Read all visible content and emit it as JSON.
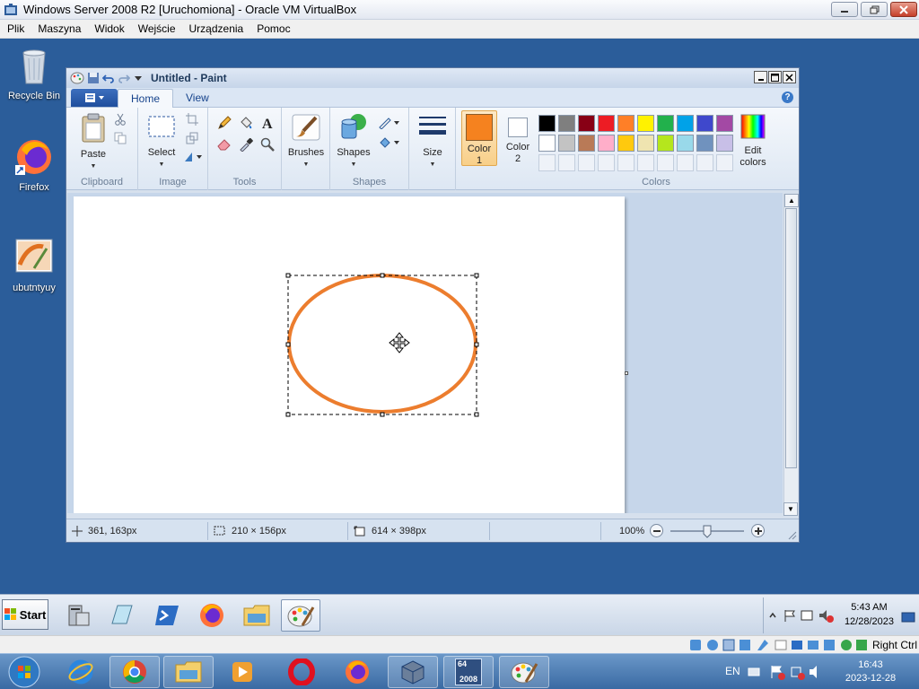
{
  "vbox": {
    "title": "Windows Server 2008 R2 [Uruchomiona] - Oracle VM VirtualBox",
    "menu": [
      "Plik",
      "Maszyna",
      "Widok",
      "Wejście",
      "Urządzenia",
      "Pomoc"
    ],
    "status_host_key": "Right Ctrl"
  },
  "desktop": {
    "icons": [
      {
        "label": "Recycle Bin",
        "icon": "recycle-bin-icon"
      },
      {
        "label": "Firefox",
        "icon": "firefox-icon"
      },
      {
        "label": "ubutntyuy",
        "icon": "paint-file-icon"
      }
    ]
  },
  "paint": {
    "title": "Untitled - Paint",
    "tabs": [
      "Home",
      "View"
    ],
    "active_tab": "Home",
    "groups": {
      "clipboard": {
        "label": "Clipboard",
        "paste": "Paste"
      },
      "image": {
        "label": "Image",
        "select": "Select"
      },
      "tools": {
        "label": "Tools"
      },
      "brushes": {
        "label": "Brushes"
      },
      "shapes": {
        "label": "Shapes",
        "shapes_btn": "Shapes"
      },
      "size": {
        "label": "Size"
      },
      "color1": {
        "line1": "Color",
        "line2": "1",
        "value": "#f5821f"
      },
      "color2": {
        "line1": "Color",
        "line2": "2",
        "value": "#ffffff"
      },
      "colors": {
        "label": "Colors",
        "edit_line1": "Edit",
        "edit_line2": "colors"
      }
    },
    "palette_row1": [
      "#000000",
      "#7f7f7f",
      "#880015",
      "#ed1c24",
      "#ff7f27",
      "#fff200",
      "#22b14c",
      "#00a2e8",
      "#3f48cc",
      "#a349a4"
    ],
    "palette_row2": [
      "#ffffff",
      "#c3c3c3",
      "#b97a57",
      "#ffaec9",
      "#ffc90e",
      "#efe4b0",
      "#b5e61d",
      "#99d9ea",
      "#7092be",
      "#c8bfe7"
    ],
    "shape_color": "#ec7d2e",
    "status": {
      "cursor_pos": "361, 163px",
      "selection_size": "210 × 156px",
      "canvas_size": "614 × 398px",
      "zoom": "100%",
      "zoom_level": 1.0
    }
  },
  "guest_taskbar": {
    "start": "Start",
    "apps": [
      "server-manager-icon",
      "explorer-files-icon",
      "powershell-icon",
      "firefox-icon",
      "folder-icon",
      "paint-icon"
    ],
    "clock_time": "5:43 AM",
    "clock_date": "12/28/2023"
  },
  "host_taskbar": {
    "lang": "EN",
    "clock_time": "16:43",
    "clock_date": "2023-12-28",
    "apps": [
      "ie-icon",
      "chrome-icon",
      "folder-icon",
      "media-player-icon",
      "opera-icon",
      "firefox-icon",
      "virtualbox-icon",
      "vm-2008-icon",
      "paint-icon"
    ],
    "vm_badge_top": "64",
    "vm_badge_bottom": "2008"
  }
}
